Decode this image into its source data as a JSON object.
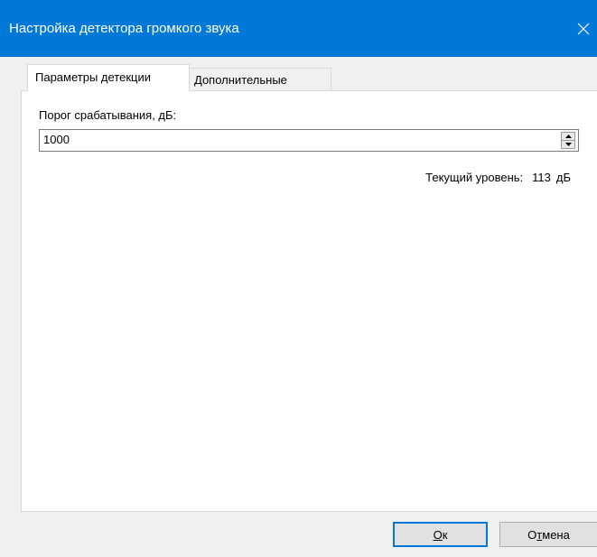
{
  "window": {
    "title": "Настройка детектора громкого звука",
    "accent_color": "#0078d7",
    "close_icon": "close-icon"
  },
  "tabs": [
    {
      "label": "Параметры детекции",
      "active": true
    },
    {
      "label": "Дополнительные",
      "active": false
    }
  ],
  "detection": {
    "threshold_label": "Порог срабатывания, дБ:",
    "threshold_value": "1000",
    "current_level_label": "Текущий уровень:",
    "current_level_value": "113",
    "current_level_unit": "дБ"
  },
  "buttons": {
    "ok": {
      "mnemonic": "О",
      "rest": "к"
    },
    "cancel": {
      "pre": "О",
      "mnemonic": "т",
      "rest": "мена"
    }
  }
}
